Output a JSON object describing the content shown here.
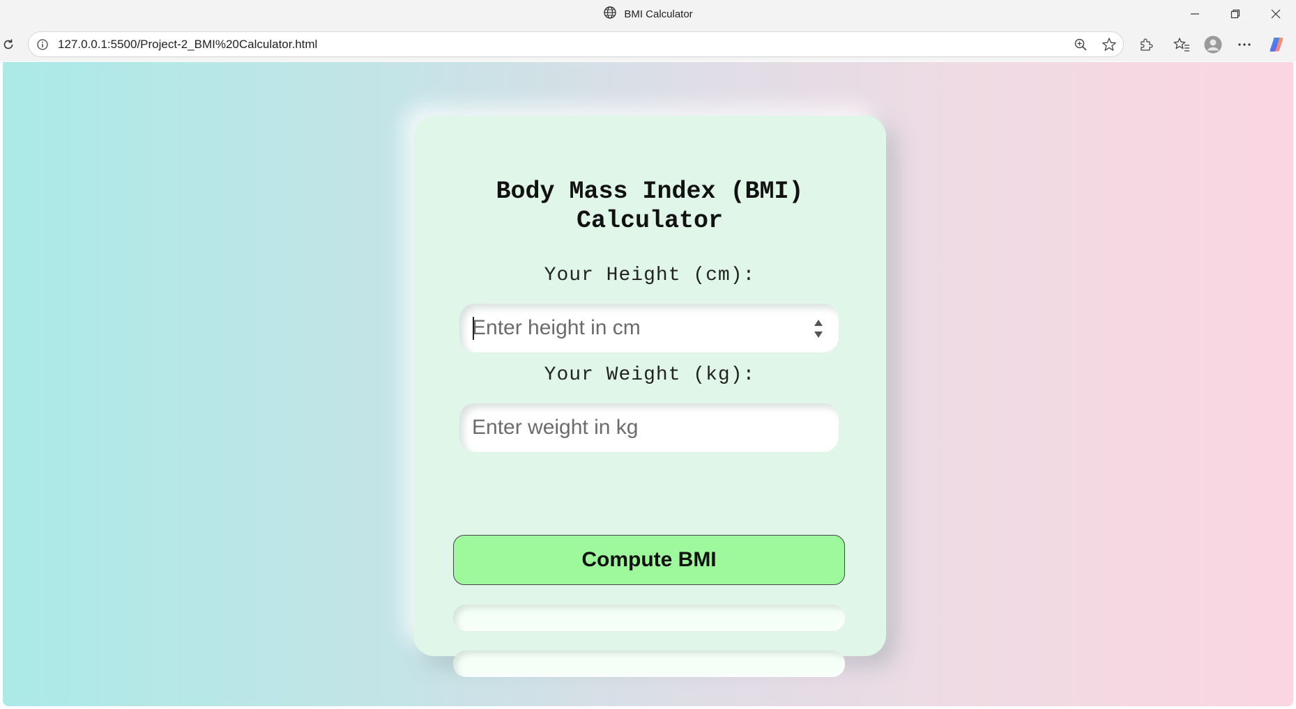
{
  "window": {
    "title": "BMI Calculator",
    "controls": [
      "minimize",
      "restore",
      "close"
    ]
  },
  "browser": {
    "url": "127.0.0.1:5500/Project-2_BMI%20Calculator.html",
    "icons": [
      "reload-icon",
      "site-info-icon",
      "zoom-icon",
      "favorite-star-icon",
      "extensions-icon",
      "favorites-icon",
      "profile-icon",
      "more-icon",
      "copilot-icon"
    ]
  },
  "page": {
    "heading": "Body Mass Index (BMI)\nCalculator",
    "height_label": "Your Height (cm):",
    "height_placeholder": "Enter height in cm",
    "weight_label": "Your Weight (kg):",
    "weight_placeholder": "Enter weight in kg",
    "compute_button": "Compute BMI",
    "result_value": "",
    "result_category": ""
  },
  "colors": {
    "card_bg": "#dff6e8",
    "button_bg": "#9ef99c",
    "gradient_left": "#abeae7",
    "gradient_right": "#fbd6e2"
  }
}
